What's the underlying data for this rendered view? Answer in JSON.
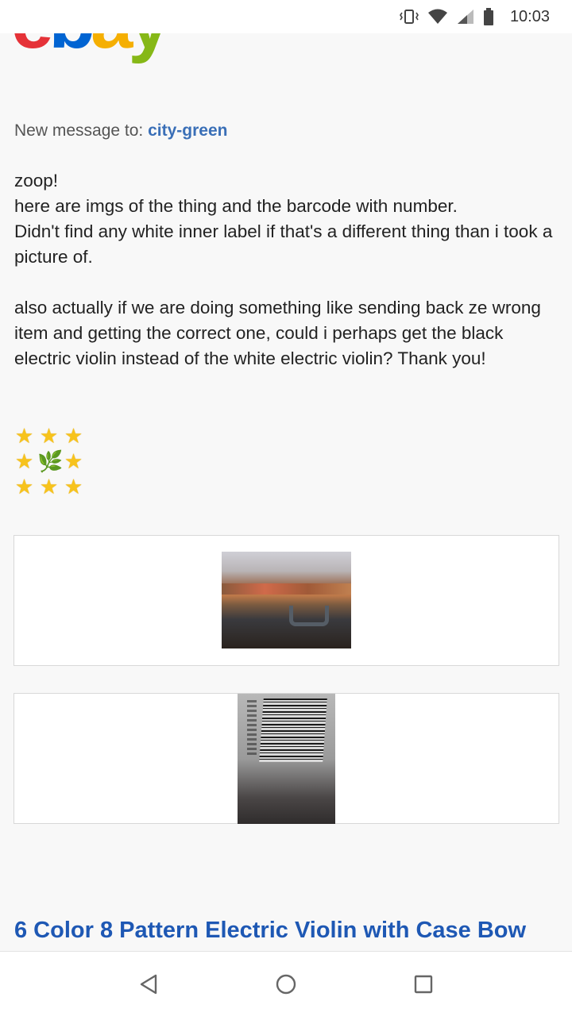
{
  "status_bar": {
    "time": "10:03",
    "icons": [
      "vibrate-icon",
      "wifi-icon",
      "signal-icon",
      "battery-icon"
    ]
  },
  "logo": {
    "letters": [
      "e",
      "b",
      "a",
      "y"
    ],
    "colors": [
      "#e53238",
      "#0064d2",
      "#f5af02",
      "#86b817"
    ]
  },
  "message": {
    "recipient_prefix": "New message to:",
    "recipient": "city-green",
    "paragraph1_line1": "zoop!",
    "paragraph1_line2": "here are imgs of the thing and the barcode with number.",
    "paragraph1_line3": "Didn't find any white inner label if that's a different thing than i took a picture of.",
    "paragraph2": "also actually if we are doing something like sending back ze wrong item and getting the correct one, could i perhaps get the black electric violin instead of the white electric violin? Thank you!",
    "emoji_rows": [
      [
        "★",
        "★",
        "★"
      ],
      [
        "★",
        "🌿",
        "★"
      ],
      [
        "★",
        "★",
        "★"
      ]
    ]
  },
  "attachments": [
    "case-photo",
    "barcode-photo"
  ],
  "item": {
    "title": "6 Color 8 Pattern Electric Violin with Case Bow"
  },
  "nav_bar": {
    "buttons": [
      "back-icon",
      "home-icon",
      "recents-icon"
    ]
  },
  "colors": {
    "link": "#3a6fb7",
    "title_blue": "#1e58b4",
    "star": "#f7c31c"
  }
}
